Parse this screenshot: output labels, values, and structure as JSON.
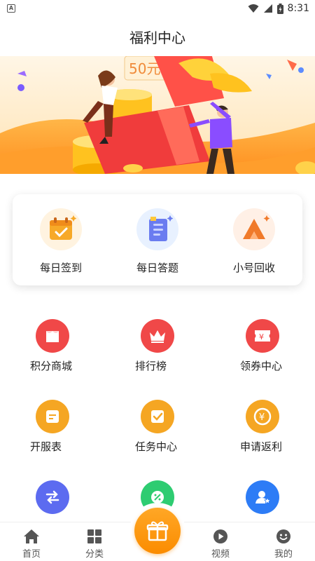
{
  "status": {
    "time": "8:31"
  },
  "header": {
    "title": "福利中心"
  },
  "banner": {
    "price_text": "50元"
  },
  "quick": [
    {
      "label": "每日签到",
      "icon": "calendar-check-icon"
    },
    {
      "label": "每日答题",
      "icon": "quiz-list-icon"
    },
    {
      "label": "小号回收",
      "icon": "recycle-triangle-icon"
    }
  ],
  "grid": [
    {
      "label": "积分商城",
      "icon": "store-icon",
      "color": "#f04848"
    },
    {
      "label": "排行榜",
      "icon": "crown-icon",
      "color": "#f04848"
    },
    {
      "label": "领券中心",
      "icon": "coupon-icon",
      "color": "#f04848"
    },
    {
      "label": "开服表",
      "icon": "server-list-icon",
      "color": "#f5a623"
    },
    {
      "label": "任务中心",
      "icon": "task-check-icon",
      "color": "#f5a623"
    },
    {
      "label": "申请返利",
      "icon": "yuan-coin-icon",
      "color": "#f5a623"
    },
    {
      "label": "",
      "icon": "swap-icon",
      "color": "#5c6bf0"
    },
    {
      "label": "",
      "icon": "discount-icon",
      "color": "#2ecc71"
    },
    {
      "label": "",
      "icon": "user-star-icon",
      "color": "#2d7cf6"
    }
  ],
  "tabs": [
    {
      "label": "首页",
      "icon": "home-icon"
    },
    {
      "label": "分类",
      "icon": "category-grid-icon"
    },
    {
      "label": "",
      "icon": "gift-icon"
    },
    {
      "label": "视频",
      "icon": "video-play-icon"
    },
    {
      "label": "我的",
      "icon": "profile-face-icon"
    }
  ],
  "colors": {
    "accent": "#fb8c00",
    "red": "#f04848",
    "orange": "#f5a623",
    "purple": "#5c6bf0",
    "green": "#2ecc71",
    "blue": "#2d7cf6"
  }
}
